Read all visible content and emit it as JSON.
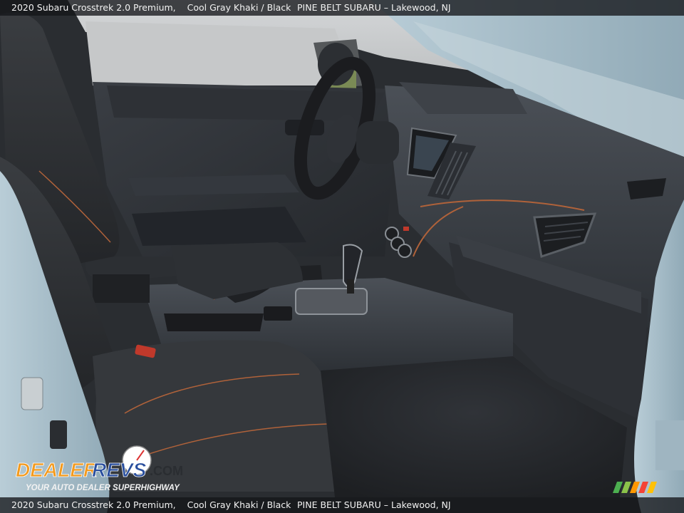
{
  "caption": {
    "vehicle": "2020 Subaru Crosstrek 2.0 Premium,",
    "colors": "Cool Gray Khaki / Black",
    "dealer": "PINE BELT SUBARU – Lakewood, NJ"
  },
  "watermark": {
    "brand": "DealerRevs.com",
    "tagline": "Your Auto Dealer SuperHighway"
  },
  "colors": {
    "cabin_dark": "#2b2e33",
    "exterior_blue": "#a9c0cc",
    "stitch_orange": "#b0623a",
    "logo_orange": "#f39a1e",
    "logo_blue": "#2a4f9e"
  }
}
